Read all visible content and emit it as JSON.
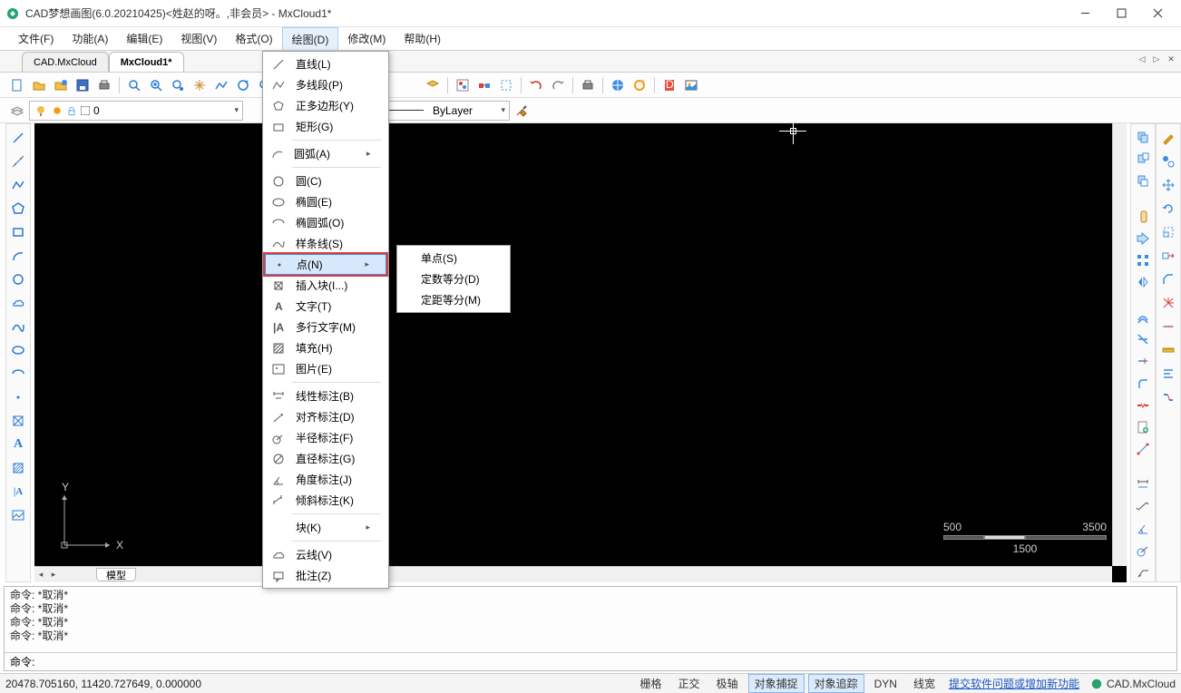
{
  "title": "CAD梦想画图(6.0.20210425)<姓赵的呀。,非会员> - MxCloud1*",
  "menus": {
    "file": "文件(F)",
    "function": "功能(A)",
    "edit": "编辑(E)",
    "view": "视图(V)",
    "format": "格式(O)",
    "draw": "绘图(D)",
    "modify": "修改(M)",
    "help": "帮助(H)"
  },
  "doc_tabs": {
    "t1": "CAD.MxCloud",
    "t2": "MxCloud1*"
  },
  "prop": {
    "layer": "0",
    "linetype": "ByLayer"
  },
  "draw_menu": [
    {
      "k": "line",
      "label": "直线(L)"
    },
    {
      "k": "pline",
      "label": "多线段(P)"
    },
    {
      "k": "polygon",
      "label": "正多边形(Y)"
    },
    {
      "k": "rect",
      "label": "矩形(G)"
    },
    {
      "sep": true
    },
    {
      "k": "arc",
      "label": "圆弧(A)",
      "sub": true
    },
    {
      "sep": true
    },
    {
      "k": "circle",
      "label": "圆(C)"
    },
    {
      "k": "ellipse",
      "label": "椭圆(E)"
    },
    {
      "k": "elarc",
      "label": "椭圆弧(O)"
    },
    {
      "k": "spline",
      "label": "样条线(S)"
    },
    {
      "k": "point",
      "label": "点(N)",
      "sub": true,
      "hl": true
    },
    {
      "k": "insert",
      "label": "插入块(I...)"
    },
    {
      "k": "text",
      "label": "文字(T)"
    },
    {
      "k": "mtext",
      "label": "多行文字(M)"
    },
    {
      "k": "hatch",
      "label": "填充(H)"
    },
    {
      "k": "image",
      "label": "图片(E)"
    },
    {
      "sep": true
    },
    {
      "k": "dimlin",
      "label": "线性标注(B)"
    },
    {
      "k": "dimalign",
      "label": "对齐标注(D)"
    },
    {
      "k": "dimrad",
      "label": "半径标注(F)"
    },
    {
      "k": "dimdia",
      "label": "直径标注(G)"
    },
    {
      "k": "dimang",
      "label": "角度标注(J)"
    },
    {
      "k": "dimobl",
      "label": "倾斜标注(K)"
    },
    {
      "sep": true
    },
    {
      "k": "block",
      "label": "块(K)",
      "sub": true
    },
    {
      "sep": true
    },
    {
      "k": "cloud",
      "label": "云线(V)"
    },
    {
      "k": "annot",
      "label": "批注(Z)"
    }
  ],
  "point_submenu": [
    {
      "k": "single",
      "label": "单点(S)"
    },
    {
      "k": "divide",
      "label": "定数等分(D)"
    },
    {
      "k": "measure",
      "label": "定距等分(M)"
    }
  ],
  "cmd_history": [
    "命令:  *取消*",
    "命令:  *取消*",
    "命令:  *取消*",
    "命令:  *取消*"
  ],
  "cmd_prompt": "命令:",
  "sheet_tab": "模型",
  "scale": {
    "t1": "500",
    "t2": "3500",
    "b": "1500"
  },
  "ucs": {
    "x": "X",
    "y": "Y"
  },
  "status": {
    "coords": "20478.705160,  11420.727649,  0.000000",
    "grid": "栅格",
    "ortho": "正交",
    "polar": "极轴",
    "osnap": "对象捕捉",
    "otrack": "对象追踪",
    "dyn": "DYN",
    "lw": "线宽",
    "link": "提交软件问题或增加新功能",
    "brand": "CAD.MxCloud"
  }
}
